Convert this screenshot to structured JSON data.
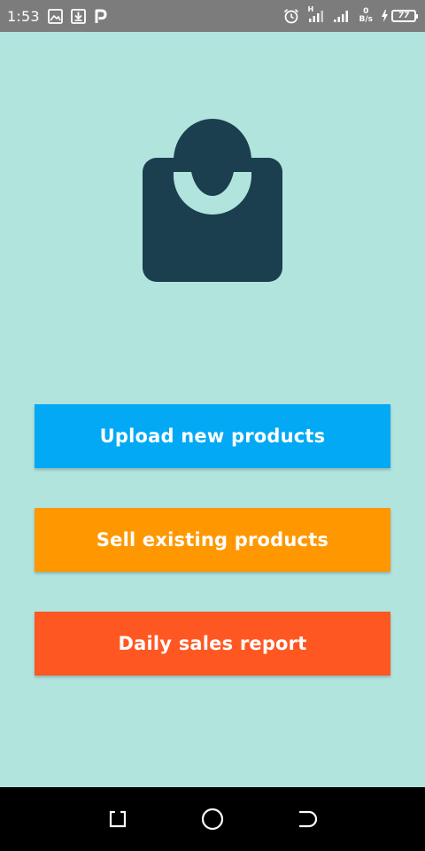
{
  "status_bar": {
    "time": "1:53",
    "net_top": "0",
    "net_bottom": "B/s",
    "battery": "77",
    "signal_h": "H",
    "icons": [
      "image-icon",
      "download-icon",
      "p-app-icon",
      "alarm-icon",
      "signal-icon",
      "signal-icon-2",
      "charging-icon",
      "battery-icon"
    ]
  },
  "logo": {
    "icon": "shopping-bag-icon",
    "color": "#1b3f4f"
  },
  "buttons": {
    "upload": "Upload new products",
    "sell": "Sell existing products",
    "report": "Daily sales report"
  },
  "colors": {
    "background": "#b2e4de",
    "upload": "#03a9f4",
    "sell": "#ff9800",
    "report": "#ff5722",
    "status_bar": "#7c7c7c",
    "nav_bar": "#000000"
  },
  "nav_bar": {
    "icons": [
      "recents-icon",
      "home-icon",
      "back-icon"
    ]
  }
}
